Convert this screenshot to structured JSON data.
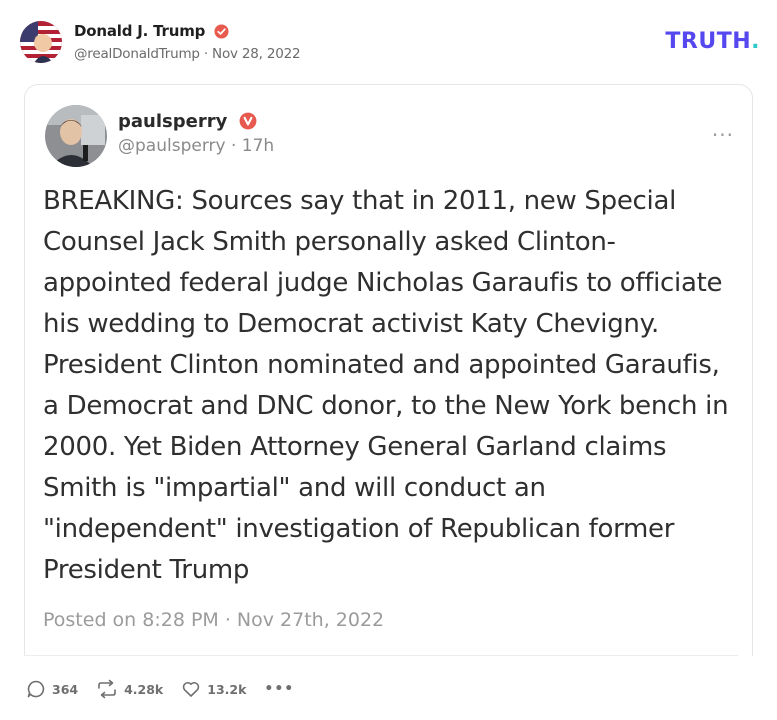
{
  "outer_post": {
    "author_name": "Donald J. Trump",
    "handle_date": "@realDonaldTrump · Nov 28, 2022",
    "logo_text": "TRUTH",
    "logo_dot": "."
  },
  "quoted_post": {
    "author_name": "paulsperry",
    "handle_time": "@paulsperry · 17h",
    "more_label": "···",
    "body": "BREAKING: Sources say that in 2011, new Special Counsel Jack Smith personally asked Clinton-appointed federal judge Nicholas Garaufis to officiate his wedding to Democrat activist Katy Chevigny. President Clinton nominated and appointed Garaufis, a Democrat and DNC donor, to the New York bench in 2000. Yet Biden Attorney General Garland claims Smith is \"impartial\" and will conduct an \"independent\" investigation of Republican former President Trump",
    "posted_text": "Posted on 8:28 PM · Nov 27th, 2022"
  },
  "actions": {
    "replies": "364",
    "retruths": "4.28k",
    "likes": "13.2k",
    "more": "•••"
  },
  "icons": {
    "verified_outer": "verified-badge-icon",
    "verified_inner": "verified-badge-icon",
    "reply": "comment-icon",
    "retruth": "repost-icon",
    "like": "heart-icon"
  },
  "colors": {
    "brand_purple": "#5448ee",
    "brand_teal": "#2fc7c7",
    "verified_red": "#e8594f"
  }
}
